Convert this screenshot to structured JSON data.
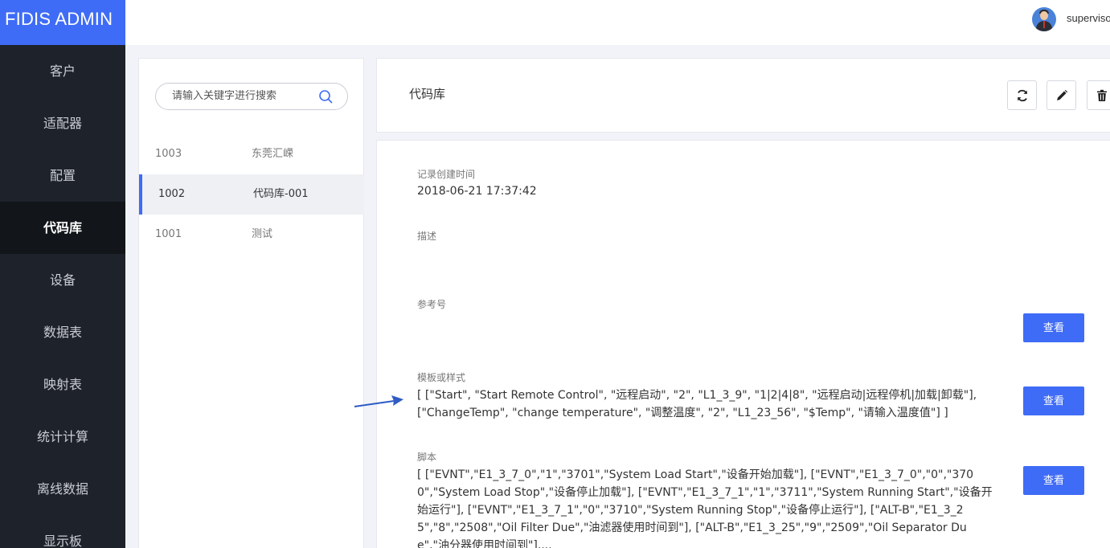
{
  "app": {
    "title": "FIDIS ADMIN"
  },
  "sidebar": {
    "items": [
      {
        "label": "客户"
      },
      {
        "label": "适配器"
      },
      {
        "label": "配置"
      },
      {
        "label": "代码库",
        "active": true
      },
      {
        "label": "设备"
      },
      {
        "label": "数据表"
      },
      {
        "label": "映射表"
      },
      {
        "label": "统计计算"
      },
      {
        "label": "离线数据"
      },
      {
        "label": "显示板"
      }
    ]
  },
  "topbar": {
    "username": "supervisor"
  },
  "list": {
    "search_placeholder": "请输入关键字进行搜索",
    "rows": [
      {
        "id": "1003",
        "name": "东莞汇嵘"
      },
      {
        "id": "1002",
        "name": "代码库-001",
        "active": true
      },
      {
        "id": "1001",
        "name": "测试"
      }
    ]
  },
  "header": {
    "title": "代码库"
  },
  "detail": {
    "created_label": "记录创建时间",
    "created_value": "2018-06-21 17:37:42",
    "description_label": "描述",
    "description_value": "",
    "reference_label": "参考号",
    "reference_value": "",
    "template_label": "模板或样式",
    "template_value": "[ [\"Start\", \"Start Remote Control\", \"远程启动\", \"2\", \"L1_3_9\", \"1|2|4|8\", \"远程启动|远程停机|加载|卸载\"], [\"ChangeTemp\", \"change temperature\", \"调整温度\", \"2\", \"L1_23_56\", \"$Temp\", \"请输入温度值\"] ]",
    "script_label": "脚本",
    "script_value": "[ [\"EVNT\",\"E1_3_7_0\",\"1\",\"3701\",\"System Load Start\",\"设备开始加载\"], [\"EVNT\",\"E1_3_7_0\",\"0\",\"3700\",\"System Load Stop\",\"设备停止加载\"], [\"EVNT\",\"E1_3_7_1\",\"1\",\"3711\",\"System Running Start\",\"设备开始运行\"], [\"EVNT\",\"E1_3_7_1\",\"0\",\"3710\",\"System Running Stop\",\"设备停止运行\"], [\"ALT-B\",\"E1_3_25\",\"8\",\"2508\",\"Oil Filter Due\",\"油滤器使用时间到\"], [\"ALT-B\",\"E1_3_25\",\"9\",\"2509\",\"Oil Separator Due\",\"油分器使用时间到\"],...",
    "view_label": "查看"
  },
  "colors": {
    "accent": "#3f6cf6",
    "sidebar_bg": "#1e222b",
    "sidebar_active_bg": "#121519"
  },
  "icons": {
    "search": "search-icon",
    "refresh": "refresh-icon",
    "edit": "pencil-icon",
    "delete": "trash-icon",
    "annotation": "arrow-icon"
  }
}
